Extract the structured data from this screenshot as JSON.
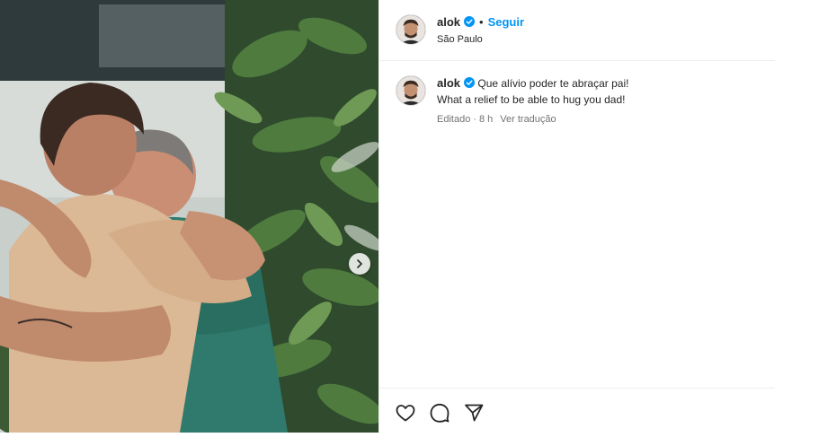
{
  "post": {
    "photo_alt": "",
    "author": {
      "username": "alok",
      "verified": true,
      "follow_label": "Seguir",
      "location": "São Paulo"
    },
    "caption": {
      "username": "alok",
      "line1": "Que alívio poder te abraçar pai!",
      "line2": "What a relief to be able to hug you dad!",
      "status": "Editado",
      "age": "8 h",
      "translate_label": "Ver tradução"
    },
    "colors": {
      "accent": "#0095f6",
      "text": "#262626",
      "muted": "#737373",
      "border": "#efefef"
    },
    "icons": [
      "verified-badge-icon",
      "chevron-right-icon",
      "heart-icon",
      "comment-icon",
      "share-icon"
    ]
  }
}
